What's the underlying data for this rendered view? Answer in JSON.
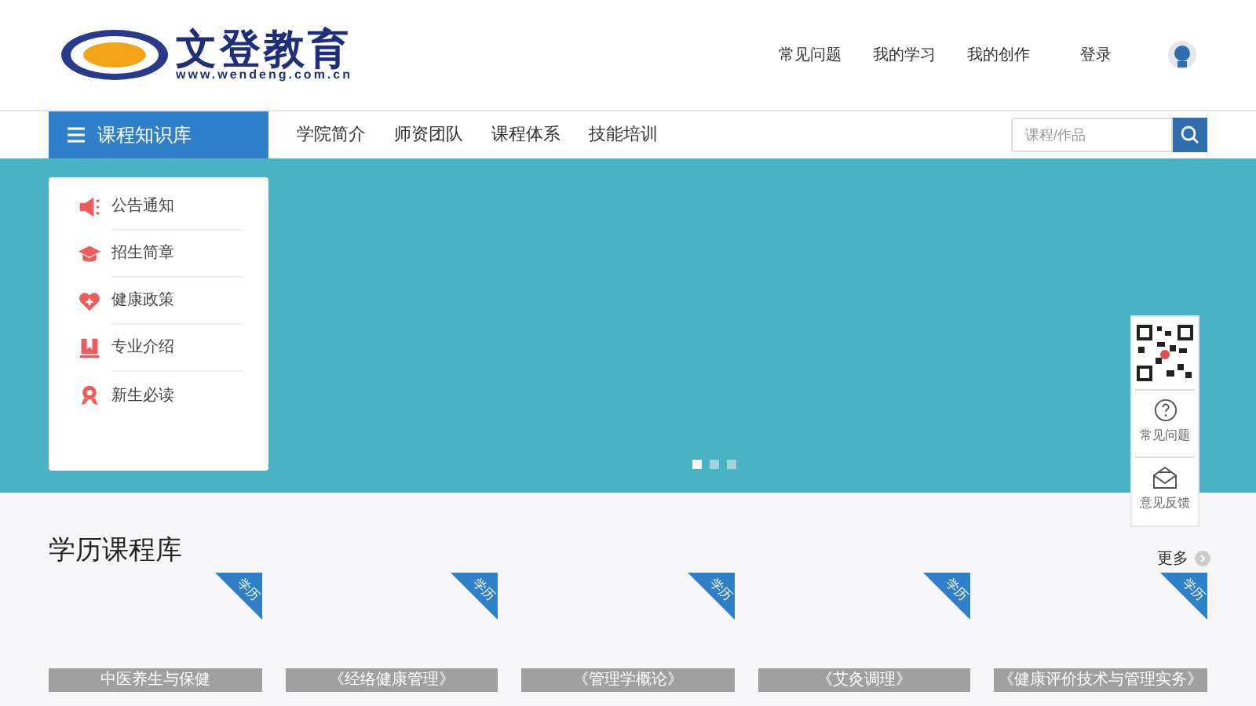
{
  "logo": {
    "name": "文登教育",
    "url": "www.wendeng.com.cn"
  },
  "top_links": [
    "常见问题",
    "我的学习",
    "我的创作",
    "登录"
  ],
  "nav": {
    "category_button": "课程知识库",
    "items": [
      "学院简介",
      "师资团队",
      "课程体系",
      "技能培训"
    ],
    "search": {
      "placeholder": "课程/作品"
    }
  },
  "side_menu": [
    {
      "label": "公告通知"
    },
    {
      "label": "招生简章"
    },
    {
      "label": "健康政策"
    },
    {
      "label": "专业介绍"
    },
    {
      "label": "新生必读"
    }
  ],
  "carousel_dots": [
    {
      "selected": true
    },
    {
      "selected": false
    },
    {
      "selected": false
    }
  ],
  "float_widget": {
    "items": [
      {
        "label": "常见问题",
        "kind": "help"
      },
      {
        "label": "意见反馈",
        "kind": "mail"
      }
    ]
  },
  "section": {
    "title": "学历课程库",
    "more": "更多",
    "courses": [
      {
        "tag": "学历",
        "title": "中医养生与保健"
      },
      {
        "tag": "学历",
        "title": "《经络健康管理》"
      },
      {
        "tag": "学历",
        "title": "《管理学概论》"
      },
      {
        "tag": "学历",
        "title": "《艾灸调理》"
      },
      {
        "tag": "学历",
        "title": "《健康评价技术与管理实务》"
      }
    ]
  }
}
